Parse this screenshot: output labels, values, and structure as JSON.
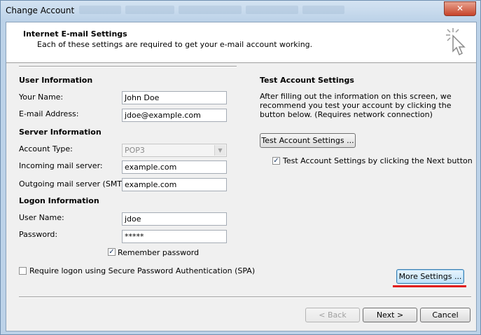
{
  "window": {
    "title": "Change Account",
    "close_label": "✕"
  },
  "header": {
    "title": "Internet E-mail Settings",
    "subtitle": "Each of these settings are required to get your e-mail account working."
  },
  "user_info": {
    "heading": "User Information",
    "name_label": "Your Name:",
    "name_value": "John Doe",
    "email_label": "E-mail Address:",
    "email_value": "jdoe@example.com"
  },
  "server_info": {
    "heading": "Server Information",
    "account_type_label": "Account Type:",
    "account_type_value": "POP3",
    "incoming_label": "Incoming mail server:",
    "incoming_value": "example.com",
    "outgoing_label": "Outgoing mail server (SMTP):",
    "outgoing_value": "example.com"
  },
  "logon_info": {
    "heading": "Logon Information",
    "username_label": "User Name:",
    "username_value": "jdoe",
    "password_label": "Password:",
    "password_value": "*****",
    "remember_label": "Remember password",
    "remember_checked": true,
    "spa_label": "Require logon using Secure Password Authentication (SPA)",
    "spa_checked": false
  },
  "test": {
    "heading": "Test Account Settings",
    "description": "After filling out the information on this screen, we recommend you test your account by clicking the button below. (Requires network connection)",
    "button_label": "Test Account Settings ...",
    "next_check_label": "Test Account Settings by clicking the Next button",
    "next_check_checked": true
  },
  "buttons": {
    "more_settings": "More Settings ...",
    "back": "< Back",
    "next": "Next >",
    "cancel": "Cancel"
  },
  "colors": {
    "highlight_underline": "#e01b1b"
  }
}
